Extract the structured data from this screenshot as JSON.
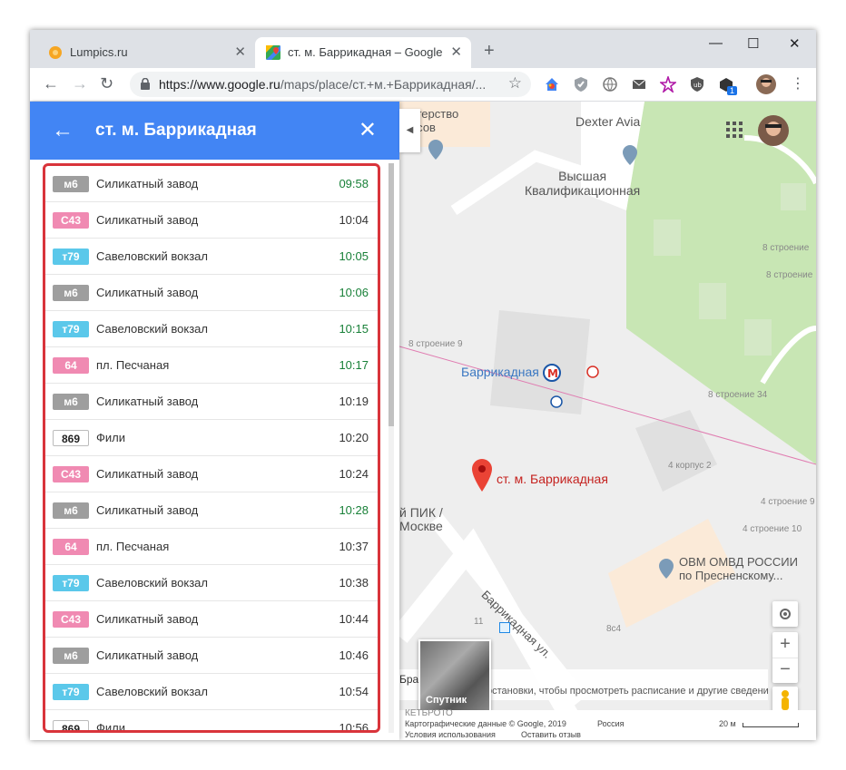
{
  "browser": {
    "tabs": [
      {
        "title": "Lumpics.ru",
        "active": false
      },
      {
        "title": "ст. м. Баррикадная – Google Ка",
        "active": true
      }
    ],
    "new_tab": "+",
    "window_controls": {
      "minimize": "—",
      "maximize": "☐",
      "close": "✕"
    },
    "url_prefix": "https://www.google.ru",
    "url_rest": "/maps/place/ст.+м.+Баррикадная/...",
    "extension_badge": "1"
  },
  "panel": {
    "title": "ст. м. Баррикадная",
    "departures": [
      {
        "route": "м6",
        "dest": "Силикатный завод",
        "time": "09:58",
        "live": true,
        "color": "#9e9e9e"
      },
      {
        "route": "С43",
        "dest": "Силикатный завод",
        "time": "10:04",
        "live": false,
        "color": "#f08ab2"
      },
      {
        "route": "т79",
        "dest": "Савеловский вокзал",
        "time": "10:05",
        "live": true,
        "color": "#5bc8ea"
      },
      {
        "route": "м6",
        "dest": "Силикатный завод",
        "time": "10:06",
        "live": true,
        "color": "#9e9e9e"
      },
      {
        "route": "т79",
        "dest": "Савеловский вокзал",
        "time": "10:15",
        "live": true,
        "color": "#5bc8ea"
      },
      {
        "route": "64",
        "dest": "пл. Песчаная",
        "time": "10:17",
        "live": true,
        "color": "#f08ab2"
      },
      {
        "route": "м6",
        "dest": "Силикатный завод",
        "time": "10:19",
        "live": false,
        "color": "#9e9e9e"
      },
      {
        "route": "869",
        "dest": "Фили",
        "time": "10:20",
        "live": false,
        "color": "#ffffff"
      },
      {
        "route": "С43",
        "dest": "Силикатный завод",
        "time": "10:24",
        "live": false,
        "color": "#f08ab2"
      },
      {
        "route": "м6",
        "dest": "Силикатный завод",
        "time": "10:28",
        "live": true,
        "color": "#9e9e9e"
      },
      {
        "route": "64",
        "dest": "пл. Песчаная",
        "time": "10:37",
        "live": false,
        "color": "#f08ab2"
      },
      {
        "route": "т79",
        "dest": "Савеловский вокзал",
        "time": "10:38",
        "live": false,
        "color": "#5bc8ea"
      },
      {
        "route": "С43",
        "dest": "Силикатный завод",
        "time": "10:44",
        "live": false,
        "color": "#f08ab2"
      },
      {
        "route": "м6",
        "dest": "Силикатный завод",
        "time": "10:46",
        "live": false,
        "color": "#9e9e9e"
      },
      {
        "route": "т79",
        "dest": "Савеловский вокзал",
        "time": "10:54",
        "live": false,
        "color": "#5bc8ea"
      },
      {
        "route": "869",
        "dest": "Фили",
        "time": "10:56",
        "live": false,
        "color": "#ffffff"
      }
    ]
  },
  "map": {
    "labels": {
      "ministry": "стерство\nнсов",
      "dexter": "Dexter Avia",
      "school": "Высшая\nКвалификационная",
      "metro": "Баррикадная",
      "pin": "ст. м. Баррикадная",
      "pik": "й ПИК /\nМоскве",
      "street": "Баррикадная ул.",
      "ovm": "ОВМ ОМВД РОССИИ\nпо Пресненскому...",
      "b8_1": "8 строение",
      "b8_2": "8 строение",
      "b8_9": "8 строение 9",
      "b8_34": "8 строение 34",
      "k4_2": "4 корпус 2",
      "s4_9": "4 строение 9",
      "s4_10": "4 строение 10",
      "n11": "11",
      "n8c4": "8с4",
      "metro_letter": "M"
    },
    "satellite": "Спутник",
    "info_strip": "Бранс",
    "info_text": "остановки, чтобы просмотреть расписание и другие сведени",
    "footer": {
      "data": "Картографические данные © Google, 2019",
      "region": "Россия",
      "terms": "Условия использования",
      "feedback": "Оставить отзыв",
      "scale": "20 м",
      "partial": "КЕТБРОТО"
    },
    "controls": {
      "zoom_in": "+",
      "zoom_out": "−"
    }
  }
}
